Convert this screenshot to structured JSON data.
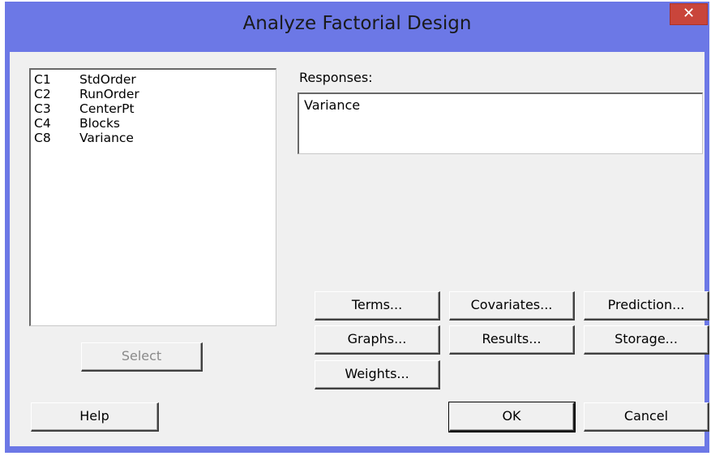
{
  "dialog": {
    "title": "Analyze Factorial Design",
    "close_glyph": "✕"
  },
  "variables_list": [
    {
      "id": "C1",
      "name": "StdOrder"
    },
    {
      "id": "C2",
      "name": "RunOrder"
    },
    {
      "id": "C3",
      "name": "CenterPt"
    },
    {
      "id": "C4",
      "name": "Blocks"
    },
    {
      "id": "C8",
      "name": "Variance"
    }
  ],
  "responses": {
    "label": "Responses:",
    "value": "Variance"
  },
  "buttons": {
    "select": "Select",
    "terms": "Terms...",
    "covariates": "Covariates...",
    "prediction": "Prediction...",
    "graphs": "Graphs...",
    "results": "Results...",
    "storage": "Storage...",
    "weights": "Weights...",
    "help": "Help",
    "ok": "OK",
    "cancel": "Cancel"
  },
  "colors": {
    "frame": "#6c78e6",
    "close_button": "#c9453b",
    "client_background": "#f0f0f0"
  }
}
